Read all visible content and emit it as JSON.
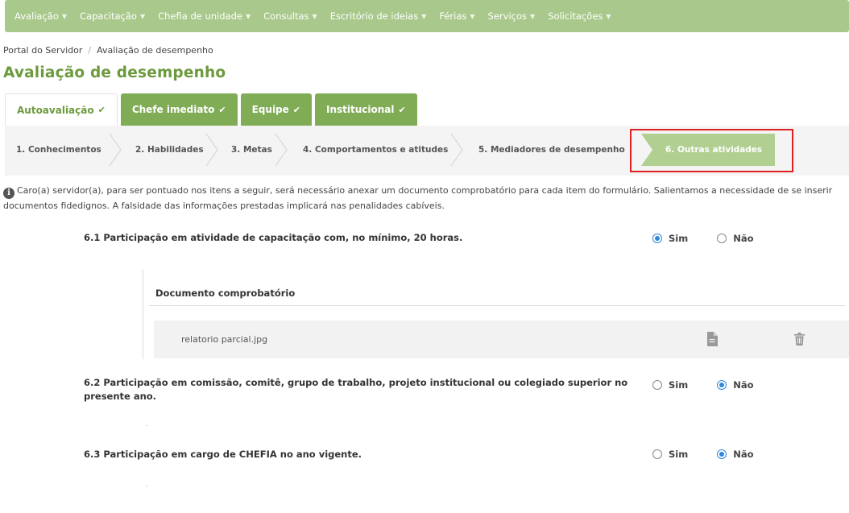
{
  "nav": {
    "items": [
      {
        "label": "Avaliação"
      },
      {
        "label": "Capacitação"
      },
      {
        "label": "Chefia de unidade"
      },
      {
        "label": "Consultas"
      },
      {
        "label": "Escritório de ideias"
      },
      {
        "label": "Férias"
      },
      {
        "label": "Serviços"
      },
      {
        "label": "Solicitações"
      }
    ],
    "caret": "▼"
  },
  "breadcrumb": {
    "root": "Portal do Servidor",
    "separator": "/",
    "current": "Avaliação de desempenho"
  },
  "page_title": "Avaliação de desempenho",
  "tabs": [
    {
      "label": "Autoavaliação",
      "check": "✔",
      "active": true
    },
    {
      "label": "Chefe imediato",
      "check": "✔",
      "active": false
    },
    {
      "label": "Equipe",
      "check": "✔",
      "active": false
    },
    {
      "label": "Institucional",
      "check": "✔",
      "active": false
    }
  ],
  "steps": [
    {
      "label": "1. Conhecimentos",
      "current": false
    },
    {
      "label": "2. Habilidades",
      "current": false
    },
    {
      "label": "3. Metas",
      "current": false
    },
    {
      "label": "4. Comportamentos e atitudes",
      "current": false
    },
    {
      "label": "5. Mediadores de desempenho",
      "current": false
    },
    {
      "label": "6. Outras atividades",
      "current": true
    }
  ],
  "info": {
    "icon": "info-icon",
    "text": "Caro(a) servidor(a), para ser pontuado nos itens a seguir, será necessário anexar um documento comprobatório para cada item do formulário. Salientamos a necessidade de se inserir documentos fidedignos. A falsidade das informações prestadas implicará nas penalidades cabíveis."
  },
  "questions": [
    {
      "text": "6.1 Participação em atividade de capacitação com, no mínimo, 20 horas.",
      "options": [
        {
          "label": "Sim",
          "selected": true
        },
        {
          "label": "Não",
          "selected": false
        }
      ]
    },
    {
      "text": "6.2 Participação em comissão, comitê, grupo de trabalho, projeto institucional ou colegiado superior no presente ano.",
      "options": [
        {
          "label": "Sim",
          "selected": false
        },
        {
          "label": "Não",
          "selected": true
        }
      ]
    },
    {
      "text": "6.3 Participação em cargo de CHEFIA no ano vigente.",
      "options": [
        {
          "label": "Sim",
          "selected": false
        },
        {
          "label": "Não",
          "selected": true
        }
      ]
    }
  ],
  "document": {
    "header": "Documento comprobatório",
    "file_name": "relatorio parcial.jpg",
    "view_icon": "file-icon",
    "delete_icon": "trash-icon"
  },
  "colors": {
    "nav_bg": "#a9c88b",
    "title_green": "#6c9a3c",
    "tab_inactive": "#7fac55",
    "step_current": "#b2cf92",
    "highlight": "#e02020",
    "radio_selected": "#2e86de"
  }
}
